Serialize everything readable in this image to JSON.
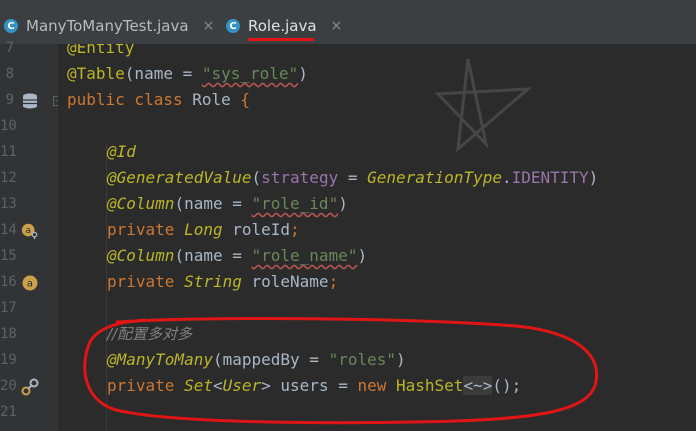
{
  "tabs": [
    {
      "icon": "C",
      "label": "ManyToManyTest.java",
      "close": "×"
    },
    {
      "icon": "C",
      "label": "Role.java",
      "close": "×"
    }
  ],
  "line_numbers": [
    "7",
    "8",
    "9",
    "10",
    "11",
    "12",
    "13",
    "14",
    "15",
    "16",
    "17",
    "18",
    "19",
    "20",
    "21"
  ],
  "code": {
    "l7": "@Entity",
    "l8_ann": "@Table",
    "l8_p1": "(name = ",
    "l8_str": "\"sys_role\"",
    "l8_p2": ")",
    "l9_kw": "public class ",
    "l9_name": "Role ",
    "l9_brace": "{",
    "l11": "@Id",
    "l12_ann": "@GeneratedValue",
    "l12_p1": "(",
    "l12_attr": "strategy",
    "l12_eq": " = ",
    "l12_type": "GenerationType",
    "l12_dot": ".",
    "l12_const": "IDENTITY",
    "l12_p2": ")",
    "l13_ann": "@Column",
    "l13_p1": "(name = ",
    "l13_str": "\"role_id\"",
    "l13_p2": ")",
    "l14_kw": "private ",
    "l14_type": "Long ",
    "l14_var": "roleId",
    "l14_semi": ";",
    "l15_ann": "@Column",
    "l15_p1": "(name = ",
    "l15_str": "\"role_name\"",
    "l15_p2": ")",
    "l16_kw": "private ",
    "l16_type": "String ",
    "l16_var": "roleName",
    "l16_semi": ";",
    "l18_comment": "//配置多对多",
    "l19_ann": "@ManyToMany",
    "l19_p1": "(mappedBy = ",
    "l19_str": "\"roles\"",
    "l19_p2": ")",
    "l20_kw": "private ",
    "l20_type": "Set",
    "l20_lt": "<",
    "l20_user": "User",
    "l20_gt": "> ",
    "l20_var": "users = ",
    "l20_new": "new ",
    "l20_hs": "HashSet",
    "l20_diamond": "<~>",
    "l20_end": "();"
  },
  "gutter_icons": {
    "line9": "table-icon",
    "line14": "annotation-key-icon",
    "line16": "annotation-icon",
    "line20": "relation-link-icon"
  },
  "colors": {
    "background": "#2b2b2b",
    "keyword": "#cc7832",
    "annotation": "#bbb529",
    "string": "#6a8759",
    "field": "#9876aa",
    "highlight_circle": "#e01515"
  }
}
